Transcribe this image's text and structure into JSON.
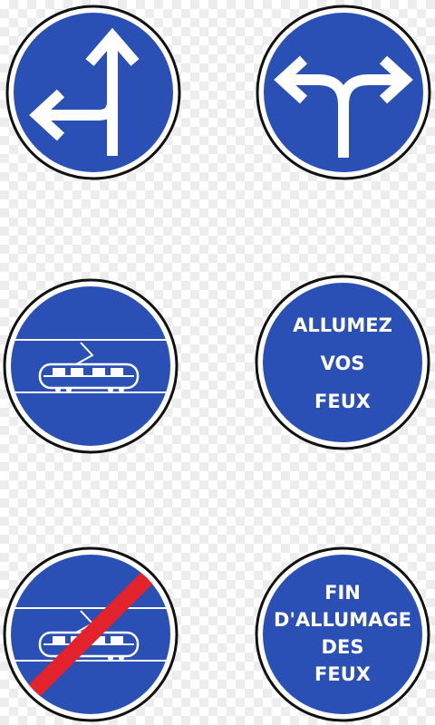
{
  "colors": {
    "sign_blue": "#2a4fb5",
    "sign_border": "#111111",
    "sign_white": "#ffffff",
    "strike_red": "#e3232b"
  },
  "signs": [
    {
      "name": "Straight ahead or turn left",
      "icon": "straight-or-left-arrow-icon"
    },
    {
      "name": "Turn left or turn right",
      "icon": "left-or-right-arrow-icon"
    },
    {
      "name": "Tram lane",
      "icon": "tram-icon"
    },
    {
      "name": "Turn on headlights",
      "lines": [
        "ALLUMEZ",
        "VOS",
        "FEUX"
      ]
    },
    {
      "name": "End of tram lane",
      "icon": "tram-icon",
      "strike": true
    },
    {
      "name": "End of headlights requirement",
      "lines": [
        "FIN",
        "D'ALLUMAGE",
        "DES",
        "FEUX"
      ]
    }
  ]
}
